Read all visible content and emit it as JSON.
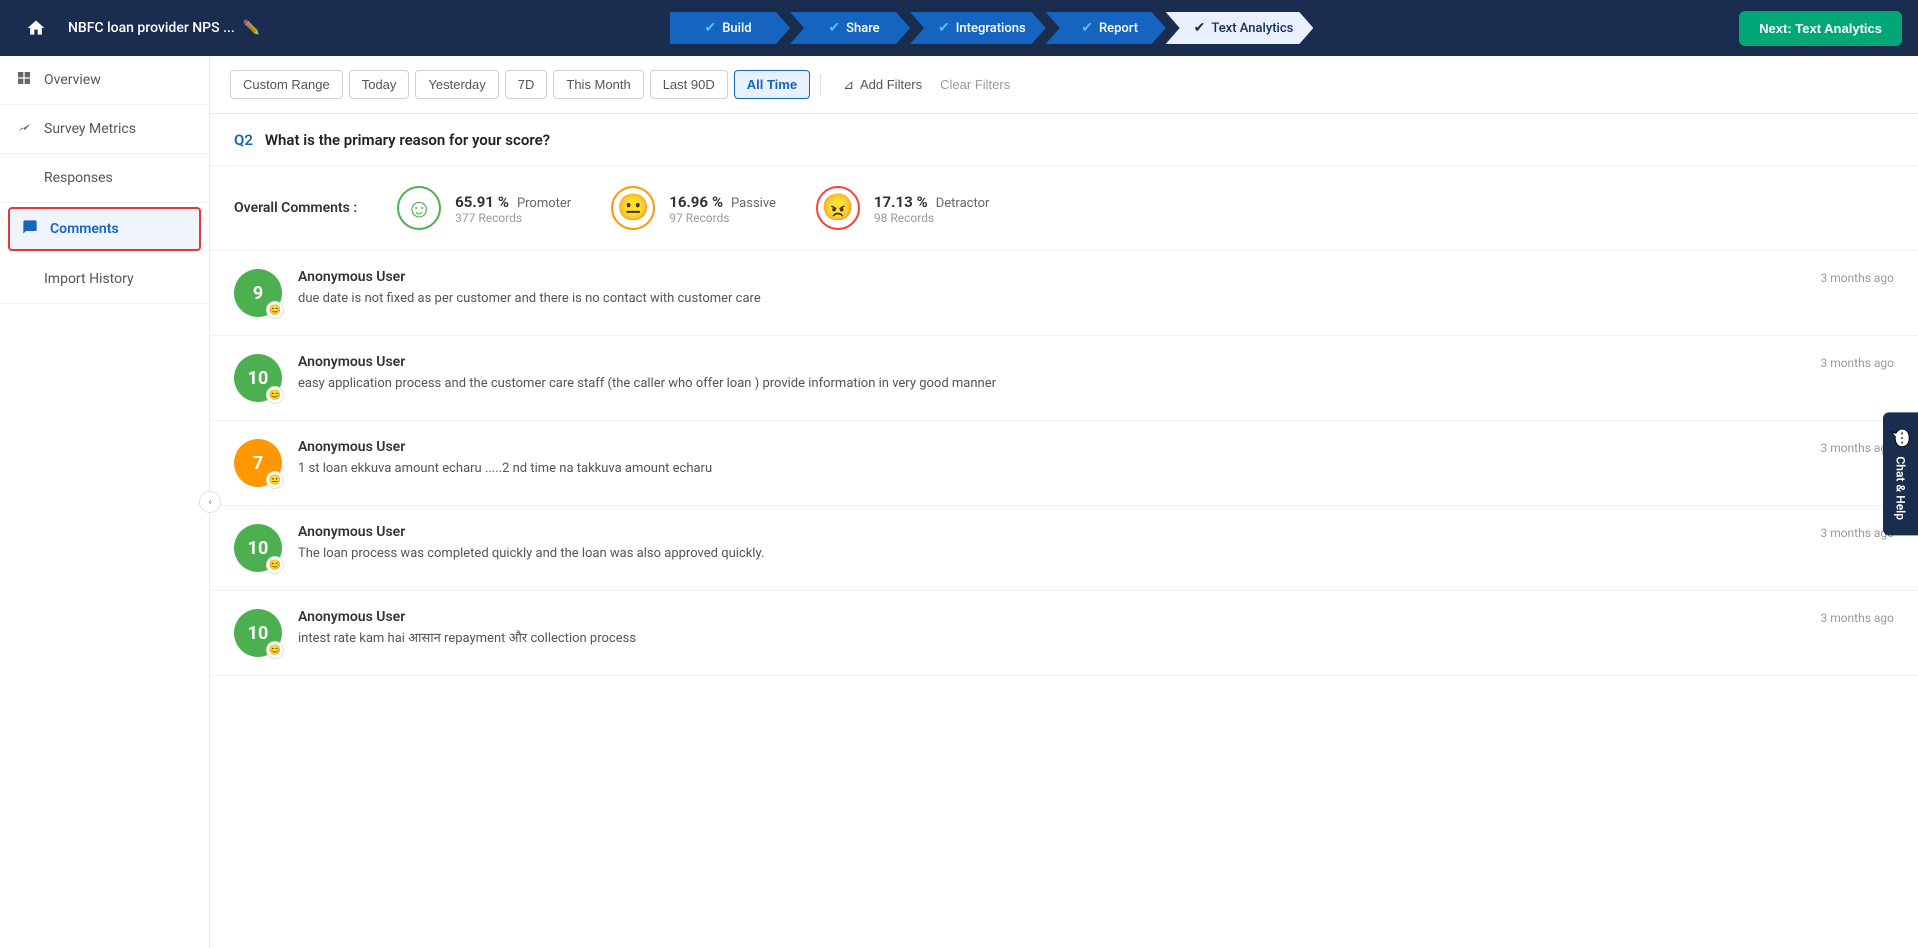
{
  "topbar": {
    "title": "NBFC loan provider NPS ...",
    "next_btn": "Next: Text Analytics",
    "steps": [
      {
        "label": "Build",
        "checked": true,
        "active": true
      },
      {
        "label": "Share",
        "checked": true,
        "active": true
      },
      {
        "label": "Integrations",
        "checked": true,
        "active": true
      },
      {
        "label": "Report",
        "checked": true,
        "active": true
      },
      {
        "label": "Text Analytics",
        "checked": true,
        "active": false,
        "highlight": true
      }
    ]
  },
  "sidebar": {
    "collapse_icon": "‹",
    "items": [
      {
        "id": "overview",
        "label": "Overview",
        "icon": "⊞"
      },
      {
        "id": "survey-metrics",
        "label": "Survey Metrics",
        "icon": "〜"
      },
      {
        "id": "responses",
        "label": "Responses",
        "icon": "☰"
      },
      {
        "id": "comments",
        "label": "Comments",
        "icon": "☰",
        "active": true
      },
      {
        "id": "import-history",
        "label": "Import History",
        "icon": "☰"
      }
    ]
  },
  "filter_bar": {
    "buttons": [
      {
        "label": "Custom Range",
        "active": false
      },
      {
        "label": "Today",
        "active": false
      },
      {
        "label": "Yesterday",
        "active": false
      },
      {
        "label": "7D",
        "active": false
      },
      {
        "label": "This Month",
        "active": false
      },
      {
        "label": "Last 90D",
        "active": false
      },
      {
        "label": "All Time",
        "active": true
      }
    ],
    "add_filters": "Add Filters",
    "clear_filters": "Clear Filters"
  },
  "question": {
    "label": "Q2",
    "text": "What is the primary reason for your score?"
  },
  "overall_comments": {
    "label": "Overall Comments :",
    "promoter": {
      "percentage": "65.91",
      "label": "Promoter",
      "records": "377 Records"
    },
    "passive": {
      "percentage": "16.96",
      "label": "Passive",
      "records": "97 Records"
    },
    "detractor": {
      "percentage": "17.13",
      "label": "Detractor",
      "records": "98 Records"
    }
  },
  "comments": [
    {
      "score": "9",
      "type": "promoter",
      "user": "Anonymous User",
      "text": "due date is not fixed as per customer and there is no contact with customer care",
      "time": "3 months ago"
    },
    {
      "score": "10",
      "type": "promoter",
      "user": "Anonymous User",
      "text": "easy application process and the customer care staff (the caller who offer loan ) provide information in very good manner",
      "time": "3 months ago"
    },
    {
      "score": "7",
      "type": "passive",
      "user": "Anonymous User",
      "text": "1 st loan ekkuva amount echaru .....2 nd time na takkuva amount echaru",
      "time": "3 months ago"
    },
    {
      "score": "10",
      "type": "promoter",
      "user": "Anonymous User",
      "text": "The loan process was completed quickly and the loan was also approved quickly.",
      "time": "3 months ago"
    },
    {
      "score": "10",
      "type": "promoter",
      "user": "Anonymous User",
      "text": "intest rate kam hai आसान repayment और collection process",
      "time": "3 months ago"
    }
  ],
  "chat_help": {
    "icon": "💬",
    "label": "Chat & Help"
  }
}
